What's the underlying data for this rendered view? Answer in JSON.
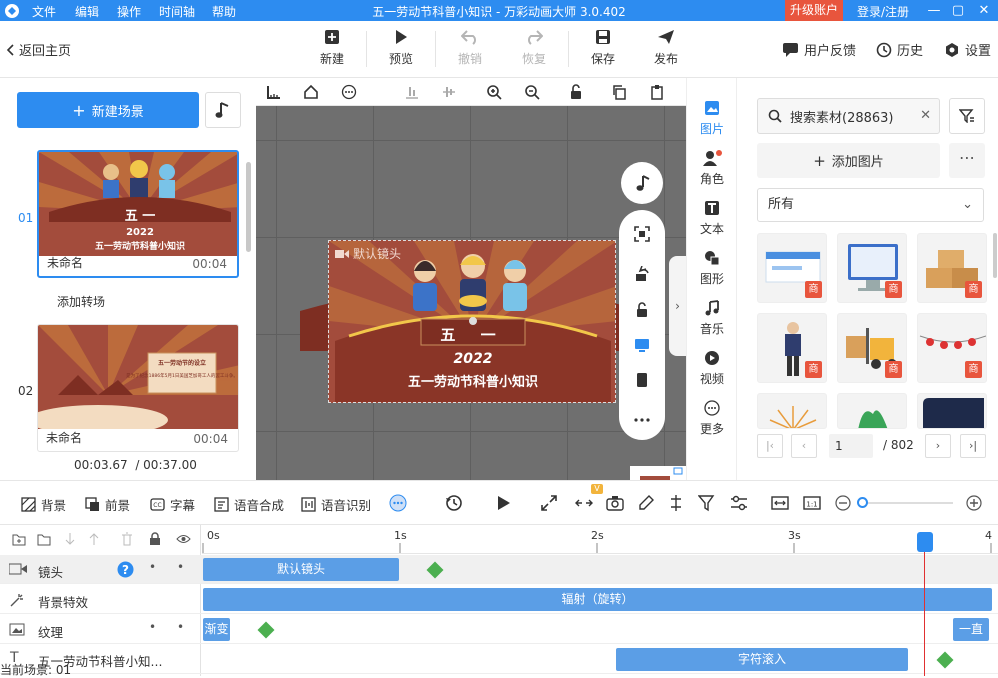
{
  "titlebar": {
    "menus": [
      "文件",
      "编辑",
      "操作",
      "时间轴",
      "帮助"
    ],
    "title": "五一劳动节科普小知识 - 万彩动画大师 3.0.402",
    "upgrade": "升级账户",
    "login": "登录/注册"
  },
  "toolbar": {
    "back": "返回主页",
    "new": "新建",
    "preview": "预览",
    "undo": "撤销",
    "redo": "恢复",
    "save": "保存",
    "publish": "发布",
    "feedback": "用户反馈",
    "history": "历史",
    "settings": "设置"
  },
  "left": {
    "new_scene": "新建场景",
    "scenes": [
      {
        "num": "01",
        "name": "未命名",
        "time": "00:04"
      },
      {
        "num": "02",
        "name": "未命名",
        "time": "00:04"
      }
    ],
    "thumb1": {
      "big": "五 一",
      "year": "2022",
      "title": "五一劳动节科普小知识"
    },
    "thumb2": {
      "title": "五一劳动节的设立",
      "body": "是为了纪念1886年5月1日美国芝加哥工人的罢工斗争。"
    },
    "transition": "添加转场",
    "current_time": "00:03.67",
    "total_time": "/ 00:37.00"
  },
  "canvas": {
    "camera_label": "默认镜头",
    "big": "五 一",
    "year": "2022",
    "title": "五一劳动节科普小知识"
  },
  "right_tabs": [
    "图片",
    "角色",
    "文本",
    "图形",
    "音乐",
    "视频",
    "更多"
  ],
  "material": {
    "search": "搜索素材(28863)",
    "add_image": "添加图片",
    "filter": "所有",
    "badge": "商",
    "page": "1",
    "total_pages": "/ 802"
  },
  "timeline_toolbar": {
    "bg": "背景",
    "fg": "前景",
    "subtitle": "字幕",
    "tts": "语音合成",
    "asr": "语音识别",
    "fx_badge": "V"
  },
  "timeline": {
    "ticks": [
      "0s",
      "1s",
      "2s",
      "3s",
      "4"
    ],
    "rows": [
      {
        "label": "镜头",
        "clip": "默认镜头"
      },
      {
        "label": "背景特效",
        "clip": "辐射（旋转）"
      },
      {
        "label": "纹理",
        "clip": "渐变",
        "clip2": "一直"
      },
      {
        "label": "五一劳动节科普小知...",
        "clip": "字符滚入"
      }
    ],
    "status": "当前场景: 01"
  },
  "colors": {
    "accent": "#2d8cf0",
    "upgrade": "#e8553d",
    "scene_bg": "#a34c3c",
    "clip": "#5b9ee6"
  }
}
